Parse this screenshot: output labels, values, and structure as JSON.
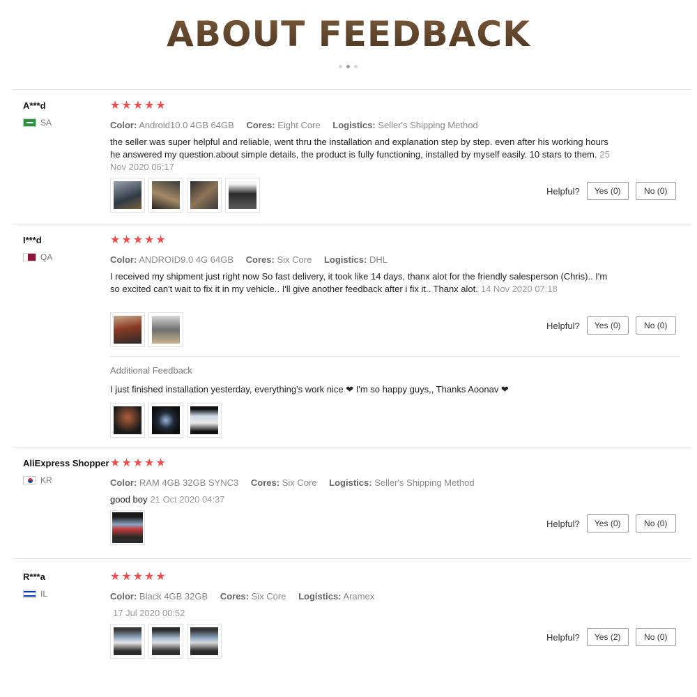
{
  "header": {
    "title": "ABOUT FEEDBACK"
  },
  "colors": {
    "star": "#ef4d4d",
    "title_brown": "#5a3f25",
    "divider": "#e3e3e3"
  },
  "labels": {
    "color": "Color:",
    "cores": "Cores:",
    "logistics": "Logistics:",
    "helpful": "Helpful?",
    "star_icon": "star-icon"
  },
  "reviews": [
    {
      "user": "A***d",
      "country": "SA",
      "stars": "★★★★★",
      "rating": 5,
      "color": "Android10.0 4GB 64GB",
      "cores": "Eight Core",
      "logistics": "Seller's Shipping Method",
      "text": "the seller was super helpful and reliable, went thru the installation and explanation step by step. even after his working hours he answered my question.about simple details, the product is fully functioning, installed by myself easily. 10 stars to them.",
      "date": "25 Nov 2020 06:17",
      "yes": "Yes (0)",
      "no": "No (0)"
    },
    {
      "user": "I***d",
      "country": "QA",
      "stars": "★★★★★",
      "rating": 5,
      "color": "ANDROID9.0 4G 64GB",
      "cores": "Six Core",
      "logistics": "DHL",
      "text": "I received my shipment just right now So fast delivery, it took like 14 days, thanx alot for the friendly salesperson (Chris).. I'm so excited can't wait to fix it in my vehicle.. I'll give another feedback after i fix it.. Thanx alot.",
      "date": "14 Nov 2020 07:18",
      "yes": "Yes (0)",
      "no": "No (0)",
      "additional_title": "Additional Feedback",
      "additional_text": "I just finished installation yesterday, everything's work nice ❤ I'm so happy guys,, Thanks Aoonav ❤"
    },
    {
      "user": "AliExpress Shopper",
      "country": "KR",
      "stars": "★★★★★",
      "rating": 5,
      "color": "RAM 4GB 32GB SYNC3",
      "cores": "Six Core",
      "logistics": "Seller's Shipping Method",
      "text": "good boy",
      "date": "21 Oct 2020 04:37",
      "yes": "Yes (0)",
      "no": "No (0)"
    },
    {
      "user": "R***a",
      "country": "IL",
      "stars": "★★★★★",
      "rating": 5,
      "color": "Black 4GB 32GB",
      "cores": "Six Core",
      "logistics": "Aramex",
      "text": "",
      "date": "17 Jul 2020 00:52",
      "yes": "Yes (2)",
      "no": "No (0)"
    }
  ]
}
